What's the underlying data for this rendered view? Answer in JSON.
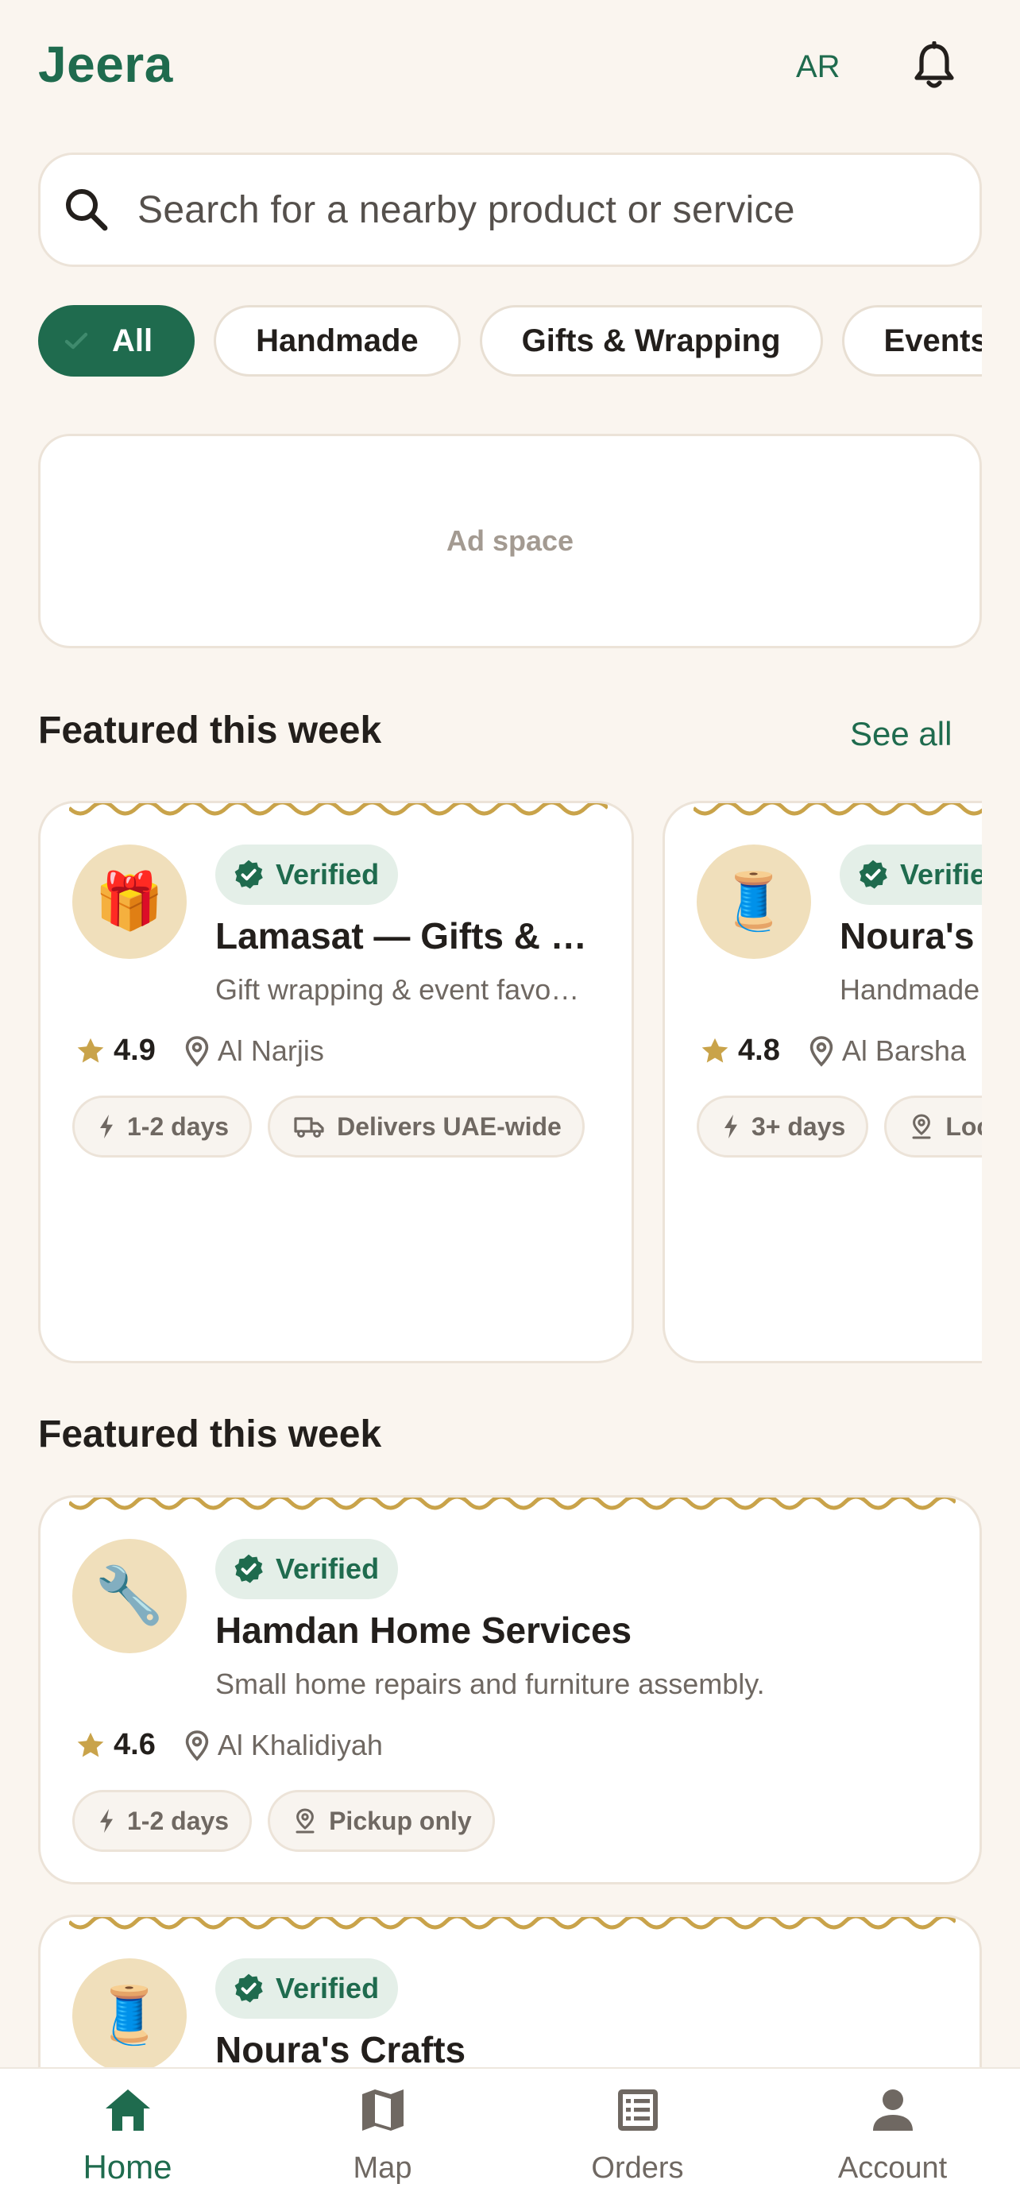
{
  "header": {
    "brand": "Jeera",
    "lang_toggle": "AR"
  },
  "search": {
    "placeholder": "Search for a nearby product or service"
  },
  "categories": [
    {
      "label": "All",
      "active": true
    },
    {
      "label": "Handmade",
      "active": false
    },
    {
      "label": "Gifts & Wrapping",
      "active": false
    },
    {
      "label": "Events",
      "active": false
    }
  ],
  "ad": {
    "label": "Ad space"
  },
  "featured_carousel": {
    "title": "Featured this week",
    "see_all": "See all",
    "cards": [
      {
        "badge": "Verified",
        "emoji": "🎁",
        "name": "Lamasat — Gifts & …",
        "desc": "Gift wrapping & event favo…",
        "rating": "4.9",
        "location": "Al Narjis",
        "tags": [
          {
            "icon": "bolt-icon",
            "label": "1-2 days"
          },
          {
            "icon": "truck-icon",
            "label": "Delivers UAE-wide"
          }
        ]
      },
      {
        "badge": "Verified",
        "emoji": "🧵",
        "name": "Noura's Crafts",
        "desc": "Handmade",
        "rating": "4.8",
        "location": "Al Barsha",
        "tags": [
          {
            "icon": "bolt-icon",
            "label": "3+ days"
          },
          {
            "icon": "pickup-icon",
            "label": "Local"
          }
        ]
      }
    ]
  },
  "featured_list": {
    "title": "Featured this week",
    "cards": [
      {
        "badge": "Verified",
        "emoji": "🔧",
        "name": "Hamdan Home Services",
        "desc": "Small home repairs and furniture assembly.",
        "rating": "4.6",
        "location": "Al Khalidiyah",
        "tags": [
          {
            "icon": "bolt-icon",
            "label": "1-2 days"
          },
          {
            "icon": "pickup-icon",
            "label": "Pickup only"
          }
        ]
      },
      {
        "badge": "Verified",
        "emoji": "🧵",
        "name": "Noura's Crafts"
      }
    ]
  },
  "bottom_nav": [
    {
      "label": "Home",
      "icon": "home-icon",
      "active": true
    },
    {
      "label": "Map",
      "icon": "map-icon",
      "active": false
    },
    {
      "label": "Orders",
      "icon": "orders-icon",
      "active": false
    },
    {
      "label": "Account",
      "icon": "account-icon",
      "active": false
    }
  ],
  "colors": {
    "brand": "#1f6b4e",
    "background": "#faf5ef",
    "gold": "#c9a34a",
    "avatar_bg": "#f0dfbb"
  }
}
